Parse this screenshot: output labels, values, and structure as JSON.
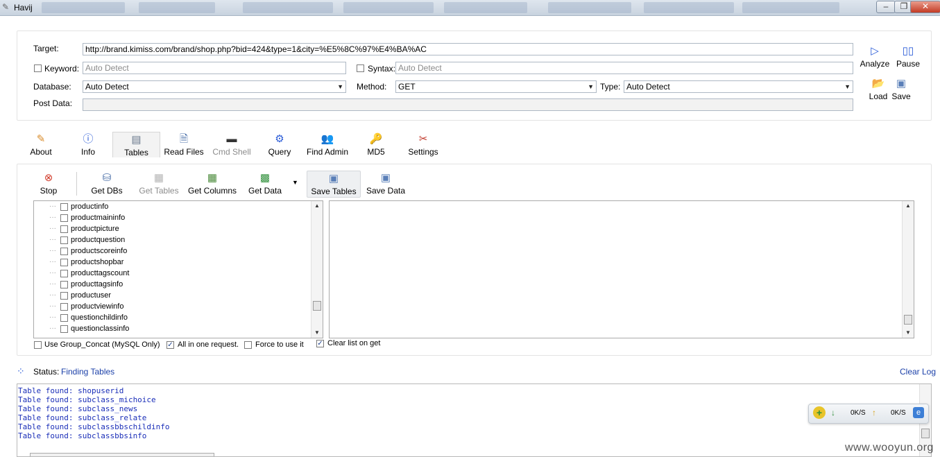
{
  "window": {
    "title": "Havij"
  },
  "target": {
    "label": "Target:",
    "value": "http://brand.kimiss.com/brand/shop.php?bid=424&type=1&city=%E5%8C%97%E4%BA%AC"
  },
  "keyword": {
    "label": "Keyword:",
    "placeholder": "Auto Detect"
  },
  "syntax": {
    "label": "Syntax:",
    "placeholder": "Auto Detect"
  },
  "database": {
    "label": "Database:",
    "value": "Auto Detect"
  },
  "method": {
    "label": "Method:",
    "value": "GET"
  },
  "type": {
    "label": "Type:",
    "value": "Auto Detect"
  },
  "post_data": {
    "label": "Post Data:"
  },
  "actions": {
    "analyze": "Analyze",
    "pause": "Pause",
    "load": "Load",
    "save": "Save"
  },
  "tabs": [
    {
      "label": "About",
      "icon": "about-icon"
    },
    {
      "label": "Info",
      "icon": "info-icon"
    },
    {
      "label": "Tables",
      "icon": "tables-icon",
      "selected": true
    },
    {
      "label": "Read Files",
      "icon": "read-files-icon"
    },
    {
      "label": "Cmd Shell",
      "icon": "cmd-shell-icon",
      "disabled": true
    },
    {
      "label": "Query",
      "icon": "query-icon"
    },
    {
      "label": "Find Admin",
      "icon": "find-admin-icon"
    },
    {
      "label": "MD5",
      "icon": "md5-icon"
    },
    {
      "label": "Settings",
      "icon": "settings-icon"
    }
  ],
  "toolbar": {
    "stop": "Stop",
    "get_dbs": "Get DBs",
    "get_tables": "Get Tables",
    "get_columns": "Get Columns",
    "get_data": "Get Data",
    "save_tables": "Save Tables",
    "save_data": "Save Data"
  },
  "tree_items": [
    "productinfo",
    "productmaininfo",
    "productpicture",
    "productquestion",
    "productscoreinfo",
    "productshopbar",
    "producttagscount",
    "producttagsinfo",
    "productuser",
    "productviewinfo",
    "questionchildinfo",
    "questionclassinfo"
  ],
  "options": {
    "group_concat": {
      "label": "Use Group_Concat (MySQL Only)",
      "checked": false
    },
    "all_in_one": {
      "label": "All in one request.",
      "checked": true
    },
    "force": {
      "label": "Force to use it",
      "checked": false
    },
    "clear_list": {
      "label": "Clear list on get",
      "checked": true
    }
  },
  "status": {
    "label": "Status:",
    "value": "Finding Tables",
    "clear_log": "Clear Log"
  },
  "log": [
    "Table found: shopuserid",
    "Table found: subclass_michoice",
    "Table found: subclass_news",
    "Table found: subclass_relate",
    "Table found: subclassbbschildinfo",
    "Table found: subclassbbsinfo"
  ],
  "netmeter": {
    "down": "0K/S",
    "up": "0K/S"
  },
  "watermark": "www.wooyun.org",
  "colors": {
    "link": "#1a3fa8",
    "log_text": "#1a2eb8",
    "accent_blue": "#2a5bd7"
  }
}
